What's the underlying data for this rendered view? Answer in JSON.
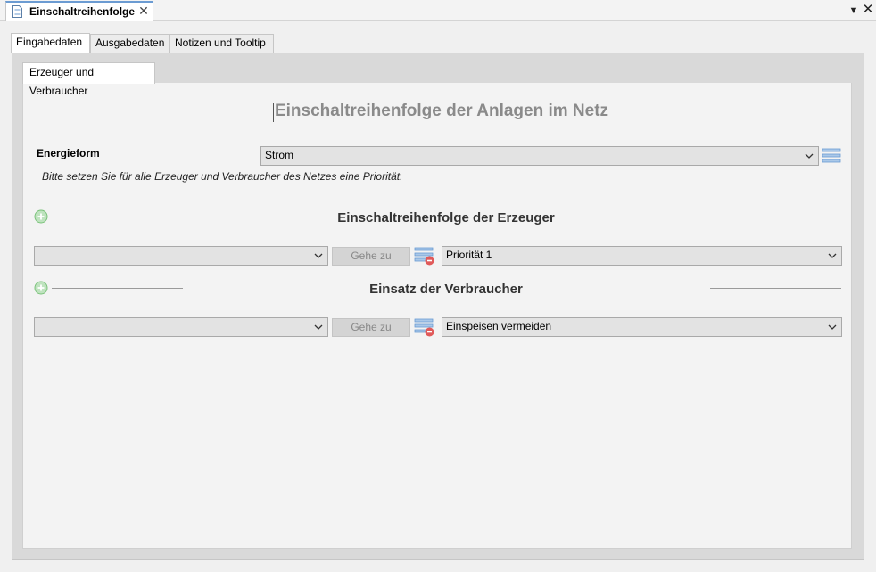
{
  "editor_tab": {
    "title": "Einschaltreihenfolge"
  },
  "icons": {
    "document": "document-icon",
    "close": "close-icon",
    "view_menu": "triangle-down-icon",
    "add": "plus-circle-icon",
    "list": "list-icon",
    "remove_list": "list-remove-icon",
    "dropdown": "chevron-down-icon"
  },
  "outer_tabs": [
    {
      "label": "Eingabedaten",
      "active": true
    },
    {
      "label": "Ausgabedaten",
      "active": false
    },
    {
      "label": "Notizen und Tooltip",
      "active": false
    }
  ],
  "inner_tab": {
    "label": "Erzeuger und Verbraucher"
  },
  "page_title": "Einschaltreihenfolge der Anlagen im Netz",
  "energy": {
    "label": "Energieform",
    "value": "Strom"
  },
  "hint": "Bitte setzen Sie für alle Erzeuger und Verbraucher des Netzes eine Priorität.",
  "producers": {
    "title": "Einschaltreihenfolge der Erzeuger",
    "select_value": "",
    "goto_label": "Gehe zu",
    "priority_value": "Priorität 1"
  },
  "consumers": {
    "title": "Einsatz der Verbraucher",
    "select_value": "",
    "goto_label": "Gehe zu",
    "usage_value": "Einspeisen vermeiden"
  },
  "colors": {
    "accent_blue": "#6b9bd2",
    "add_green": "#7ac27a",
    "remove_red": "#e05a5a",
    "title_gray": "#8a8a8a"
  }
}
